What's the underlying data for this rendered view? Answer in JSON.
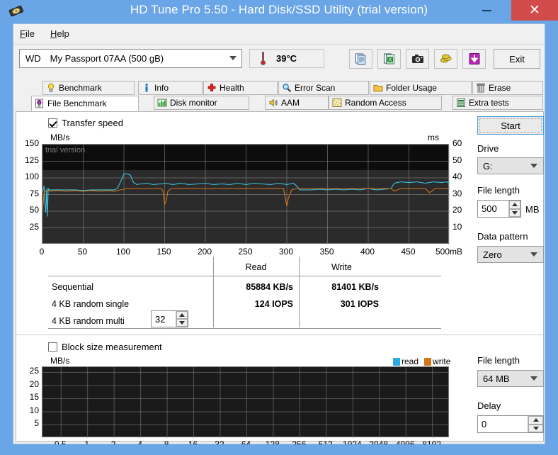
{
  "window": {
    "title": "HD Tune Pro 5.50 - Hard Disk/SSD Utility (trial version)",
    "icon": "hard-disk-icon",
    "minimize": "–",
    "maximize": "□",
    "close": "✕",
    "titlebar_color": "#6aa5e8",
    "close_color": "#d14b4b"
  },
  "menu": {
    "items": [
      {
        "label": "File",
        "accel": "F"
      },
      {
        "label": "Help",
        "accel": "H"
      }
    ]
  },
  "toolbar": {
    "drive_vendor": "WD",
    "drive_model": "My Passport 07AA (500 gB)",
    "temperature": "39°C",
    "buttons": [
      {
        "name": "copy-to-clipboard-button",
        "icon": "copy-document-icon"
      },
      {
        "name": "export-excel-button",
        "icon": "excel-export-icon"
      },
      {
        "name": "screenshot-button",
        "icon": "camera-icon"
      },
      {
        "name": "gold-coins-button",
        "icon": "coins-icon"
      },
      {
        "name": "download-button",
        "icon": "download-arrow-icon"
      }
    ],
    "exit_label": "Exit"
  },
  "tabs": {
    "row1": [
      {
        "label": "Benchmark",
        "icon": "yellow-bulb-icon",
        "active": false
      },
      {
        "label": "Info",
        "icon": "blue-info-icon",
        "active": false
      },
      {
        "label": "Health",
        "icon": "red-cross-icon",
        "active": false
      },
      {
        "label": "Error Scan",
        "icon": "magnifier-icon",
        "active": false
      },
      {
        "label": "Folder Usage",
        "icon": "folder-icon",
        "active": false
      },
      {
        "label": "Erase",
        "icon": "trash-icon",
        "active": false
      }
    ],
    "row2": [
      {
        "label": "File Benchmark",
        "icon": "purple-bulb-icon",
        "active": true
      },
      {
        "label": "Disk monitor",
        "icon": "green-bars-icon",
        "active": false
      },
      {
        "label": "AAM",
        "icon": "speaker-icon",
        "active": false
      },
      {
        "label": "Random Access",
        "icon": "dots-grid-icon",
        "active": false
      },
      {
        "label": "Extra tests",
        "icon": "calculator-icon",
        "active": false
      }
    ]
  },
  "top_panel": {
    "transfer_speed_label": "Transfer speed",
    "transfer_speed_checked": true,
    "start_label": "Start",
    "drive_label": "Drive",
    "drive_value": "G:",
    "file_length_label": "File length",
    "file_length_value": "500",
    "file_length_unit": "MB",
    "data_pattern_label": "Data pattern",
    "data_pattern_value": "Zero"
  },
  "results": {
    "headers": [
      "",
      "Read",
      "Write"
    ],
    "rows": [
      {
        "label": "Sequential",
        "read": "85884 KB/s",
        "write": "81401 KB/s"
      },
      {
        "label": "4 KB random single",
        "read": "124 IOPS",
        "write": "301 IOPS"
      },
      {
        "label": "4 KB random multi",
        "read": "",
        "write": "",
        "spinner": "32"
      }
    ]
  },
  "bottom_panel": {
    "block_size_label": "Block size measurement",
    "block_size_checked": false,
    "file_length_label": "File length",
    "file_length_value": "64 MB",
    "delay_label": "Delay",
    "delay_value": "0"
  },
  "chart_data": [
    {
      "id": "transfer-speed-chart",
      "type": "line",
      "title": "",
      "ylabel": "MB/s",
      "y2label": "ms",
      "xlabel": "",
      "watermark": "trial version",
      "xlim": [
        0,
        500
      ],
      "xticks": [
        0,
        50,
        100,
        150,
        200,
        250,
        300,
        350,
        400,
        450,
        500
      ],
      "xticklabels": [
        "0",
        "50",
        "100",
        "150",
        "200",
        "250",
        "300",
        "350",
        "400",
        "450",
        "500mB"
      ],
      "ylim": [
        0,
        150
      ],
      "yticks": [
        25,
        50,
        75,
        100,
        125,
        150
      ],
      "y2lim": [
        0,
        60
      ],
      "y2ticks": [
        10,
        20,
        30,
        40,
        50,
        60
      ],
      "grid": true,
      "legend": [
        "read",
        "write"
      ],
      "colors": {
        "read": "#3fbfe0",
        "write": "#d2761b",
        "background": "#2b2b2b",
        "grid": "#8f8f8f"
      },
      "series": [
        {
          "name": "read",
          "color": "#3fbfe0",
          "x": [
            0,
            2,
            3,
            4,
            5,
            6,
            7,
            8,
            10,
            14,
            20,
            30,
            40,
            50,
            60,
            70,
            80,
            88,
            92,
            95,
            98,
            100,
            102,
            104,
            106,
            108,
            110,
            112,
            116,
            120,
            128,
            136,
            144,
            152,
            160,
            170,
            180,
            190,
            200,
            210,
            220,
            230,
            240,
            250,
            260,
            270,
            280,
            290,
            300,
            308,
            312,
            316,
            320,
            330,
            340,
            350,
            360,
            370,
            380,
            390,
            400,
            410,
            420,
            428,
            432,
            436,
            440,
            450,
            460,
            470,
            480,
            490,
            496,
            500
          ],
          "y": [
            78,
            88,
            60,
            48,
            84,
            42,
            84,
            82,
            82,
            82,
            82,
            82,
            82,
            81,
            82,
            82,
            82,
            82,
            84,
            92,
            100,
            106,
            106,
            106,
            105,
            104,
            98,
            93,
            90,
            91,
            92,
            90,
            91,
            92,
            90,
            92,
            90,
            91,
            92,
            90,
            91,
            90,
            92,
            90,
            92,
            91,
            90,
            92,
            90,
            92,
            88,
            82,
            82,
            82,
            83,
            82,
            83,
            82,
            83,
            82,
            84,
            82,
            83,
            84,
            92,
            93,
            94,
            93,
            94,
            92,
            94,
            93,
            94,
            92
          ]
        },
        {
          "name": "write",
          "color": "#d2761b",
          "x": [
            0,
            2,
            4,
            6,
            8,
            10,
            14,
            20,
            30,
            40,
            50,
            60,
            70,
            80,
            88,
            92,
            96,
            100,
            104,
            108,
            112,
            120,
            130,
            140,
            146,
            148,
            150,
            152,
            154,
            158,
            164,
            170,
            180,
            190,
            200,
            210,
            220,
            230,
            240,
            250,
            260,
            270,
            280,
            290,
            296,
            298,
            300,
            302,
            306,
            312,
            320,
            330,
            340,
            350,
            360,
            370,
            380,
            390,
            400,
            410,
            420,
            428,
            432,
            436,
            440,
            450,
            460,
            470,
            475,
            478,
            482,
            490,
            496,
            500
          ],
          "y": [
            50,
            78,
            80,
            80,
            81,
            80,
            81,
            81,
            80,
            81,
            80,
            81,
            80,
            81,
            80,
            81,
            82,
            83,
            84,
            84,
            84,
            84,
            84,
            84,
            84,
            80,
            60,
            66,
            80,
            84,
            84,
            84,
            84,
            84,
            84,
            84,
            84,
            84,
            84,
            84,
            84,
            84,
            84,
            84,
            84,
            70,
            58,
            70,
            82,
            84,
            84,
            84,
            84,
            84,
            84,
            84,
            84,
            84,
            84,
            84,
            84,
            84,
            80,
            82,
            84,
            84,
            84,
            84,
            78,
            80,
            84,
            84,
            84,
            84
          ]
        }
      ]
    },
    {
      "id": "block-size-chart",
      "type": "line",
      "title": "",
      "ylabel": "MB/s",
      "xlabel": "",
      "xlim": [
        0.5,
        8192
      ],
      "xticklabels": [
        "0.5",
        "1",
        "2",
        "4",
        "8",
        "16",
        "32",
        "64",
        "128",
        "256",
        "512",
        "1024",
        "2048",
        "4096",
        "8192"
      ],
      "ylim": [
        0,
        27
      ],
      "yticks": [
        5,
        10,
        15,
        20,
        25
      ],
      "grid": true,
      "legend": [
        "read",
        "write"
      ],
      "colors": {
        "read": "#29abe2",
        "write": "#d2761b",
        "background": "#1a1a1a",
        "grid": "#8f8f8f"
      },
      "series": [
        {
          "name": "read",
          "color": "#29abe2",
          "x": [],
          "y": []
        },
        {
          "name": "write",
          "color": "#d2761b",
          "x": [],
          "y": []
        }
      ]
    }
  ]
}
